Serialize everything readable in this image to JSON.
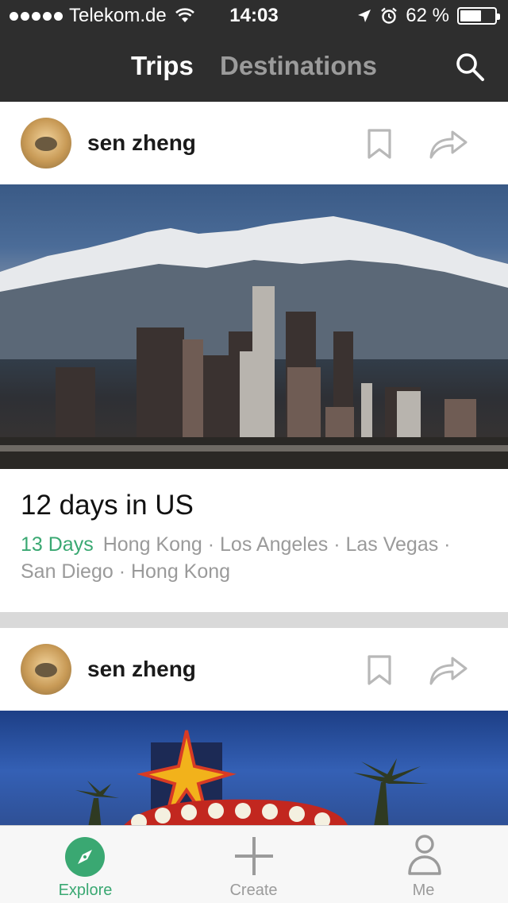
{
  "status_bar": {
    "carrier": "Telekom.de",
    "time": "14:03",
    "battery_percent": "62 %",
    "battery_level": 0.62
  },
  "nav": {
    "tabs": [
      "Trips",
      "Destinations"
    ],
    "active_tab": "Trips"
  },
  "feed": [
    {
      "user": "sen zheng",
      "title": "12 days in US",
      "days": "13 Days",
      "route": "Hong Kong · Los Angeles · Las Vegas · San Diego · Hong Kong",
      "photo": "los-angeles-skyline"
    },
    {
      "user": "sen zheng",
      "photo": "las-vegas-welcome-sign"
    }
  ],
  "tabbar": {
    "explore": "Explore",
    "create": "Create",
    "me": "Me",
    "active": "Explore"
  },
  "colors": {
    "header_bg": "#2e2e2e",
    "accent_green": "#3aa872",
    "inactive_gray": "#9b9b9b"
  },
  "icons": [
    "wifi-icon",
    "location-arrow-icon",
    "alarm-icon",
    "battery-icon",
    "search-icon",
    "bookmark-icon",
    "share-icon",
    "compass-icon",
    "plus-icon",
    "person-icon"
  ]
}
